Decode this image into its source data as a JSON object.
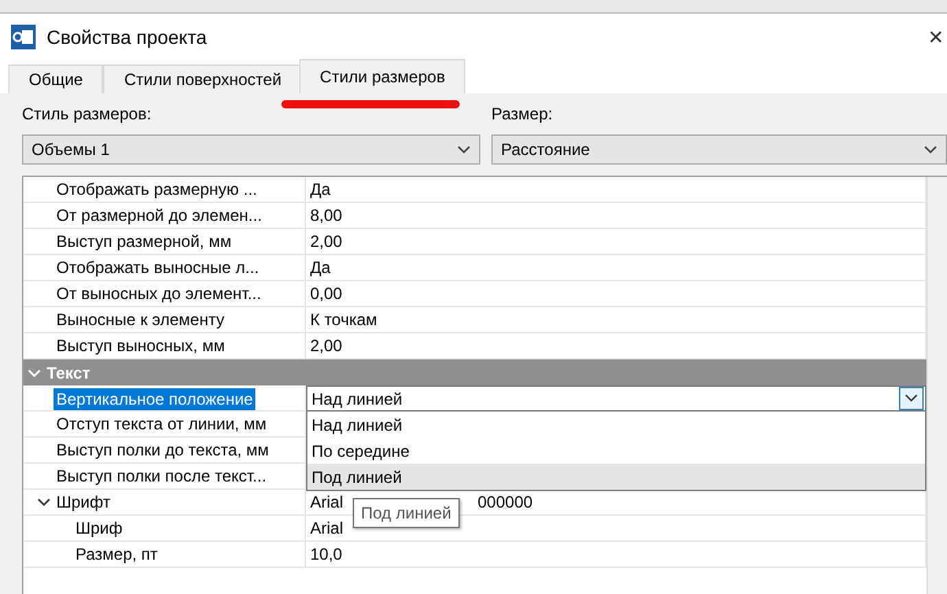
{
  "window": {
    "title": "Свойства проекта",
    "close": "✕"
  },
  "tabs": [
    {
      "label": "Общие",
      "selected": false
    },
    {
      "label": "Стили поверхностей",
      "selected": false
    },
    {
      "label": "Стили размеров",
      "selected": true
    }
  ],
  "style_field": {
    "label": "Стиль размеров:",
    "value": "Объемы 1"
  },
  "size_field": {
    "label": "Размер:",
    "value": "Расстояние"
  },
  "grid": {
    "rows": [
      {
        "kind": "prop",
        "label": "Отображать размерную ...",
        "value": "Да"
      },
      {
        "kind": "prop",
        "label": "От размерной до элемен...",
        "value": "8,00"
      },
      {
        "kind": "prop",
        "label": "Выступ размерной, мм",
        "value": "2,00"
      },
      {
        "kind": "prop",
        "label": "Отображать выносные л...",
        "value": "Да"
      },
      {
        "kind": "prop",
        "label": "От выносных до элемент...",
        "value": "0,00"
      },
      {
        "kind": "prop",
        "label": "Выносные к элементу",
        "value": "К точкам"
      },
      {
        "kind": "prop",
        "label": "Выступ выносных, мм",
        "value": "2,00"
      },
      {
        "kind": "category",
        "label": "Текст",
        "expanded": true
      },
      {
        "kind": "prop",
        "label": "Вертикальное положение",
        "value": "Над линией",
        "selected": true,
        "editing": true
      },
      {
        "kind": "prop",
        "label": "Отступ текста от линии, мм"
      },
      {
        "kind": "prop",
        "label": "Выступ полки до текста, мм"
      },
      {
        "kind": "prop",
        "label": "Выступ полки после текст..."
      },
      {
        "kind": "group",
        "label": "Шрифт",
        "expanded": true,
        "value": "Arial",
        "value_tail": "000000"
      },
      {
        "kind": "child",
        "label": "Шриф",
        "value": "Arial"
      },
      {
        "kind": "child",
        "label": "Размер, пт",
        "value": "10,0"
      }
    ]
  },
  "dropdown": {
    "options": [
      {
        "label": "Над линией",
        "hovered": false
      },
      {
        "label": "По середине",
        "hovered": false
      },
      {
        "label": "Под линией",
        "hovered": true
      }
    ]
  },
  "tooltip": {
    "text": "Под линией"
  }
}
